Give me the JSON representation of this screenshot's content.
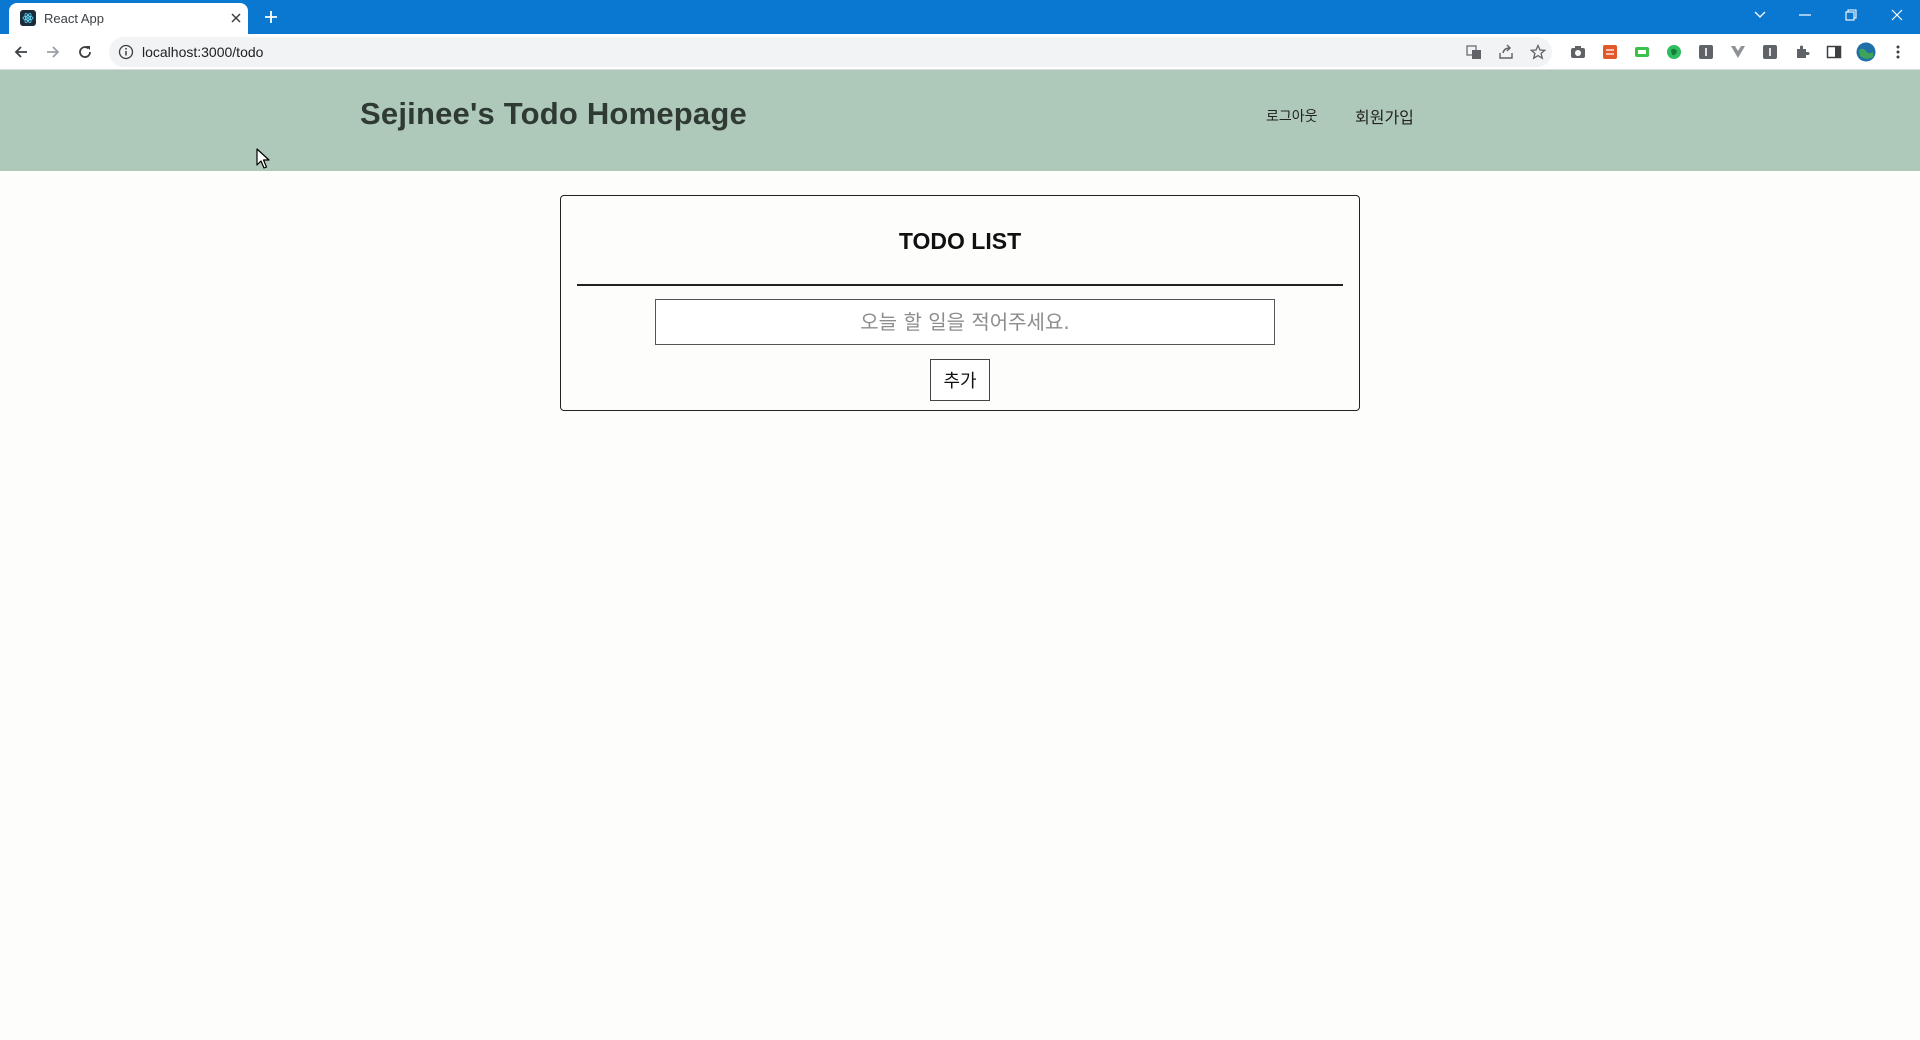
{
  "browser": {
    "tab_title": "React App",
    "url": "localhost:3000/todo"
  },
  "colors": {
    "tabstrip": "#0a78d0",
    "header_bg": "#aec9b9",
    "page_bg": "#fdfdfc"
  },
  "header": {
    "title": "Sejinee's Todo Homepage",
    "nav": {
      "logout": "로그아웃",
      "signup": "회원가입"
    }
  },
  "todo": {
    "title": "TODO LIST",
    "input_placeholder": "오늘 할 일을 적어주세요.",
    "add_label": "추가"
  }
}
